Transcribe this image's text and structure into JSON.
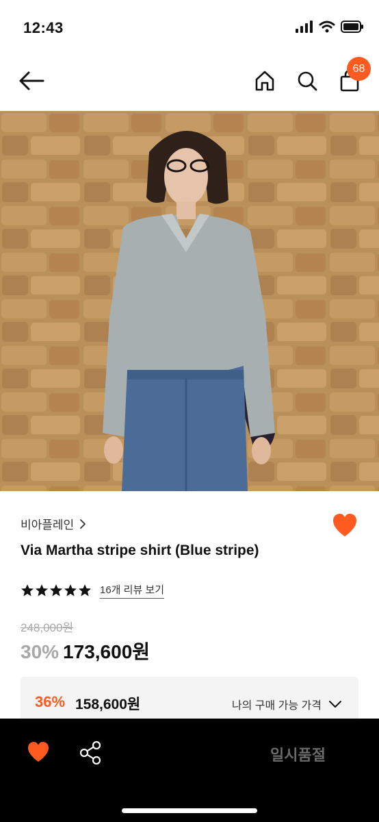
{
  "status_bar": {
    "time": "12:43"
  },
  "header": {
    "cart_badge": "68",
    "icons": [
      "back-arrow-icon",
      "home-icon",
      "search-icon",
      "shopping-bag-icon"
    ]
  },
  "product": {
    "brand": "비아플레인",
    "title": "Via Martha stripe shirt (Blue stripe)",
    "rating_stars": 5,
    "review_link": "16개 리뷰 보기",
    "original_price": "248,000원",
    "discount_rate": "30%",
    "sale_price": "173,600원"
  },
  "member_price": {
    "discount_rate": "36%",
    "price": "158,600원",
    "label": "나의 구매 가능 가격"
  },
  "bottom_bar": {
    "soldout_label": "일시품절"
  },
  "colors": {
    "accent": "#ff5a1f",
    "muted": "#a8a8a8",
    "bar": "#000000"
  }
}
